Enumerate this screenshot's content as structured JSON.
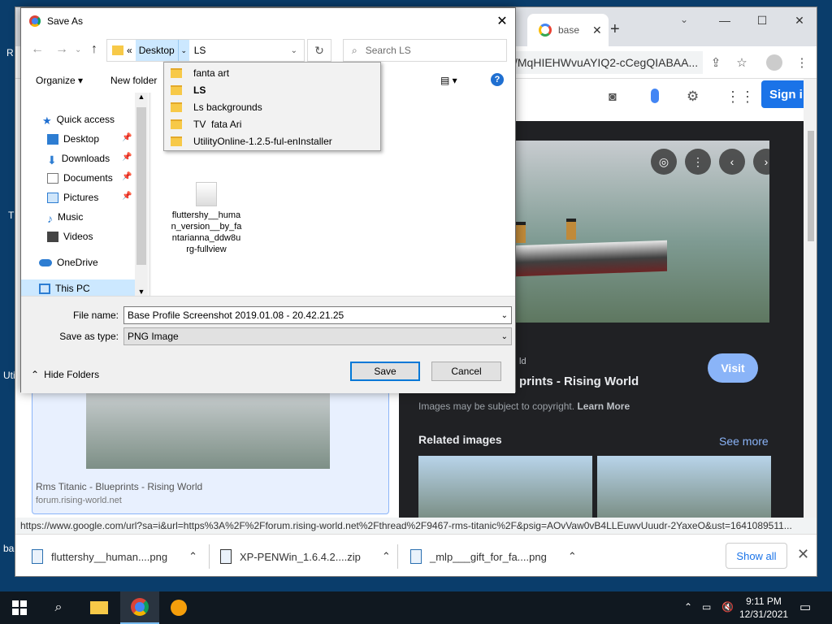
{
  "desktop": {
    "fragments": [
      "R",
      "T",
      "Uti",
      "ba"
    ]
  },
  "chrome": {
    "tab_title": "base",
    "tab_close": "✕",
    "new_tab": "+",
    "url": "/MqHIEHWvuAYIQ2-cCegQIABAA...",
    "window_min": "—",
    "window_max": "☐",
    "window_close": "✕",
    "sign_in": "Sign i"
  },
  "google": {
    "visit": "Visit",
    "source_site": "ld",
    "title_fragment": "prints - Rising World",
    "copyright": "Images may be subject to copyright.",
    "learn_more": "Learn More",
    "related_images": "Related images",
    "see_more": "See more",
    "result_title": "Rms Titanic - Blueprints - Rising World",
    "result_domain": "forum.rising-world.net"
  },
  "status_url": "https://www.google.com/url?sa=i&url=https%3A%2F%2Fforum.rising-world.net%2Fthread%2F9467-rms-titanic%2F&psig=AOvVaw0vB4LLEuwvUuudr-2YaxeO&ust=1641089511...",
  "downloads": {
    "items": [
      {
        "name": "fluttershy__human....png"
      },
      {
        "name": "XP-PENWin_1.6.4.2....zip"
      },
      {
        "name": "_mlp___gift_for_fa....png"
      }
    ],
    "show_all": "Show all",
    "close": "✕"
  },
  "dialog": {
    "title": "Save As",
    "close": "✕",
    "breadcrumb_prefix": "«",
    "breadcrumb_current": "Desktop",
    "breadcrumb_next": "LS",
    "search_placeholder": "Search LS",
    "organize": "Organize ▾",
    "new_folder": "New folder",
    "help": "?",
    "nav_items": [
      {
        "label": "Quick access"
      },
      {
        "label": "Desktop"
      },
      {
        "label": "Downloads"
      },
      {
        "label": "Documents"
      },
      {
        "label": "Pictures"
      },
      {
        "label": "Music"
      },
      {
        "label": "Videos"
      },
      {
        "label": "OneDrive"
      },
      {
        "label": "This PC"
      }
    ],
    "file_item": "fluttershy__huma n_version__by_fa ntarianna_ddw8u rg-fullview",
    "file_name_label": "File name:",
    "file_name_value": "Base Profile Screenshot 2019.01.08 - 20.42.21.25",
    "save_type_label": "Save as type:",
    "save_type_value": "PNG Image",
    "hide_folders": "Hide Folders",
    "save": "Save",
    "cancel": "Cancel"
  },
  "dropdown": {
    "items": [
      {
        "label": "fanta art",
        "bold": false
      },
      {
        "label": "LS",
        "bold": true
      },
      {
        "label": "Ls backgrounds",
        "bold": false
      },
      {
        "label": "TV  fata Ari",
        "bold": false
      },
      {
        "label": "UtilityOnline-1.2.5-ful-enInstaller",
        "bold": false
      }
    ]
  },
  "taskbar": {
    "time": "9:11 PM",
    "date": "12/31/2021"
  },
  "colors": {
    "accent": "#0078d7",
    "google_blue": "#1a73e8",
    "visit": "#8ab4f8",
    "panel": "#202124"
  }
}
